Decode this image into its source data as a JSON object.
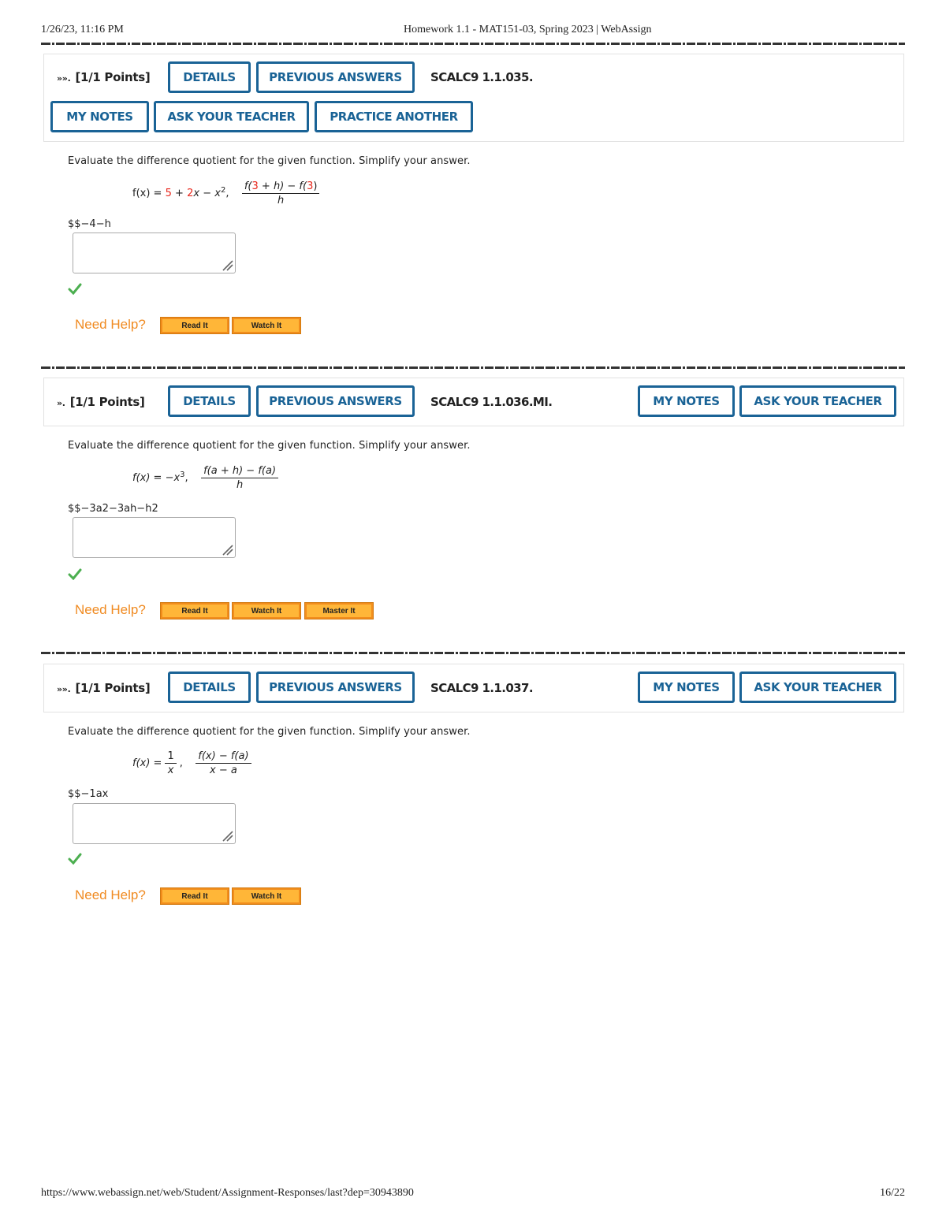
{
  "print_header": {
    "datetime": "1/26/23, 11:16 PM",
    "page_title": "Homework 1.1 - MAT151-03, Spring 2023 | WebAssign"
  },
  "print_footer": {
    "url": "https://www.webassign.net/web/Student/Assignment-Responses/last?dep=30943890",
    "page_number": "16/22"
  },
  "colors": {
    "button_blue": "#1a6396",
    "highlight_red": "#e8261b",
    "need_help_orange": "#f08b22",
    "help_button_fill": "#ffb638",
    "check_green": "#4caf50"
  },
  "questions": [
    {
      "number_marker": "»».",
      "points": "[1/1 Points]",
      "code": "SCALC9 1.1.035.",
      "buttons": {
        "details": "DETAILS",
        "previous_answers": "PREVIOUS ANSWERS",
        "my_notes": "MY NOTES",
        "ask_teacher": "ASK YOUR TEACHER",
        "practice_another": "PRACTICE ANOTHER"
      },
      "prompt": "Evaluate the difference quotient for the given function. Simplify your answer.",
      "function": {
        "lhs": "f(x) =",
        "terms": [
          "5",
          "+",
          "2",
          "x",
          "−",
          "x",
          "2",
          ","
        ],
        "quotient_numerator_parts": [
          "f(",
          "3",
          " + h) − f(",
          "3",
          ")"
        ],
        "quotient_denominator": "h"
      },
      "answer_text": "$$−4−h",
      "answer_value": "",
      "status_icon": "check-icon",
      "need_help": "Need Help?",
      "help_buttons": [
        "Read It",
        "Watch It"
      ]
    },
    {
      "number_marker": "».",
      "points": "[1/1 Points]",
      "code": "SCALC9 1.1.036.MI.",
      "buttons": {
        "details": "DETAILS",
        "previous_answers": "PREVIOUS ANSWERS",
        "my_notes": "MY NOTES",
        "ask_teacher": "ASK YOUR TEACHER"
      },
      "prompt": "Evaluate the difference quotient for the given function. Simplify your answer.",
      "function": {
        "lhs": "f(x) = −x",
        "exponent": "3",
        "after": ",",
        "quotient_numerator": "f(a + h) − f(a)",
        "quotient_denominator": "h"
      },
      "answer_text": "$$−3a2−3ah−h2",
      "answer_value": "",
      "status_icon": "check-icon",
      "need_help": "Need Help?",
      "help_buttons": [
        "Read It",
        "Watch It",
        "Master It"
      ]
    },
    {
      "number_marker": "»».",
      "points": "[1/1 Points]",
      "code": "SCALC9 1.1.037.",
      "buttons": {
        "details": "DETAILS",
        "previous_answers": "PREVIOUS ANSWERS",
        "my_notes": "MY NOTES",
        "ask_teacher": "ASK YOUR TEACHER"
      },
      "prompt": "Evaluate the difference quotient for the given function. Simplify your answer.",
      "function": {
        "lhs": "f(x) =",
        "fraction_numerator": "1",
        "fraction_denominator": "x",
        "after": ",",
        "quotient_numerator": "f(x) − f(a)",
        "quotient_denominator": "x − a"
      },
      "answer_text": "$$−1ax",
      "answer_value": "",
      "status_icon": "check-icon",
      "need_help": "Need Help?",
      "help_buttons": [
        "Read It",
        "Watch It"
      ]
    }
  ]
}
